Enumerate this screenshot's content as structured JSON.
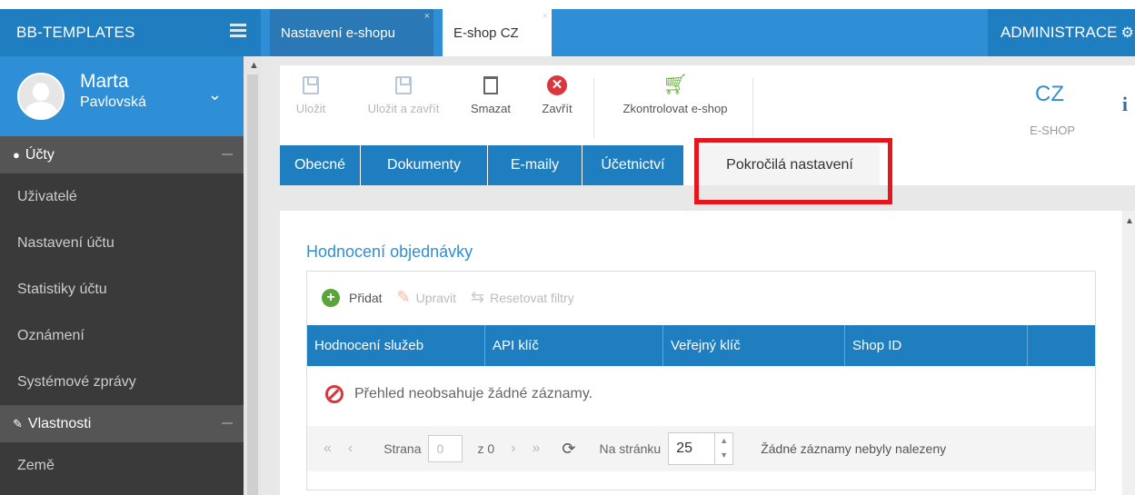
{
  "header": {
    "brand": "BB-TEMPLATES",
    "tabs": [
      {
        "label": "Nastavení e-shopu"
      },
      {
        "label": "E-shop CZ"
      }
    ],
    "admin_label": "ADMINISTRACE"
  },
  "user": {
    "first_name": "Marta",
    "last_name": "Pavlovská"
  },
  "sidebar": {
    "sections": [
      {
        "title": "Účty",
        "items": [
          "Uživatelé",
          "Nastavení účtu",
          "Statistiky účtu",
          "Oznámení",
          "Systémové zprávy"
        ]
      },
      {
        "title": "Vlastnosti",
        "items": [
          "Země"
        ]
      }
    ]
  },
  "toolbar": {
    "save": "Uložit",
    "save_close": "Uložit a zavřít",
    "delete": "Smazat",
    "close": "Zavřít",
    "check_shop": "Zkontrolovat e-shop",
    "shop_code": "CZ",
    "shop_sub": "E-SHOP"
  },
  "tabs": [
    {
      "label": "Obecné"
    },
    {
      "label": "Dokumenty"
    },
    {
      "label": "E-maily"
    },
    {
      "label": "Účetnictví"
    },
    {
      "label": "Pokročilá nastavení"
    }
  ],
  "panel": {
    "title": "Hodnocení objednávky",
    "actions": {
      "add": "Přidat",
      "edit": "Upravit",
      "reset": "Resetovat filtry"
    },
    "columns": [
      "Hodnocení služeb",
      "API klíč",
      "Veřejný klíč",
      "Shop ID",
      ""
    ],
    "empty_message": "Přehled neobsahuje žádné záznamy.",
    "pager": {
      "page_label": "Strana",
      "page_value": "0",
      "of_label": "z 0",
      "per_page_label": "Na stránku",
      "per_page_value": "25",
      "no_records": "Žádné záznamy nebyly nalezeny"
    }
  },
  "colors": {
    "primary": "#1f7ec0",
    "accent": "#2e8fd6",
    "highlight": "#e5161c"
  }
}
